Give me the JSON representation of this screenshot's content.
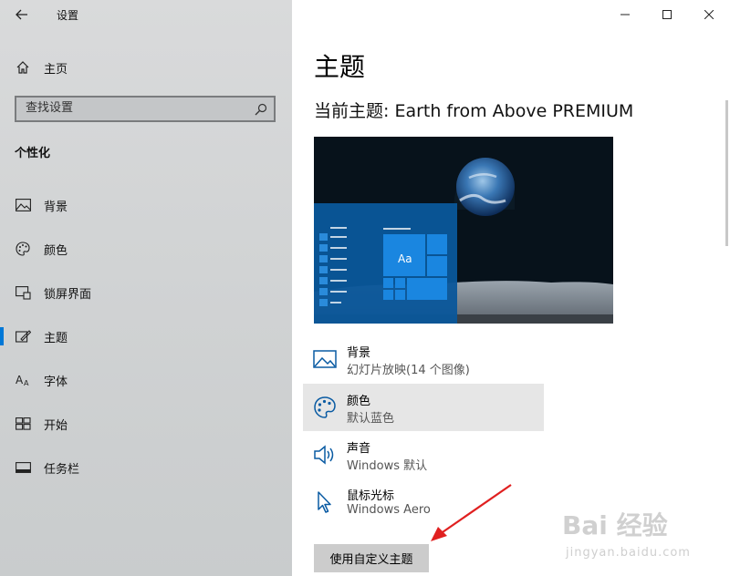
{
  "window": {
    "app_title": "设置",
    "controls": {
      "minimize": "—",
      "maximize": "☐",
      "close": "✕"
    }
  },
  "sidebar": {
    "home_label": "主页",
    "search_placeholder": "查找设置",
    "section_title": "个性化",
    "items": [
      {
        "label": "背景",
        "icon": "picture-icon"
      },
      {
        "label": "颜色",
        "icon": "palette-icon"
      },
      {
        "label": "锁屏界面",
        "icon": "lockscreen-icon"
      },
      {
        "label": "主题",
        "icon": "theme-icon",
        "active": true
      },
      {
        "label": "字体",
        "icon": "font-icon"
      },
      {
        "label": "开始",
        "icon": "start-icon"
      },
      {
        "label": "任务栏",
        "icon": "taskbar-icon"
      }
    ]
  },
  "main": {
    "page_title": "主题",
    "current_theme": "当前主题: Earth from Above PREMIUM",
    "preview_tile_text": "Aa",
    "rows": [
      {
        "name": "背景",
        "sub": "幻灯片放映(14 个图像)",
        "icon": "picture-icon"
      },
      {
        "name": "颜色",
        "sub": "默认蓝色",
        "icon": "palette-icon",
        "selected": true
      },
      {
        "name": "声音",
        "sub": "Windows 默认",
        "icon": "speaker-icon"
      },
      {
        "name": "鼠标光标",
        "sub": "Windows Aero",
        "icon": "cursor-icon"
      }
    ],
    "custom_button": "使用自定义主题"
  },
  "watermark": {
    "main": "Bai 经验",
    "sub": "jingyan.baidu.com"
  },
  "colors": {
    "accent": "#0078d7",
    "sidebar_bg": "#d2d4d5",
    "annotation_arrow": "#e02020"
  }
}
